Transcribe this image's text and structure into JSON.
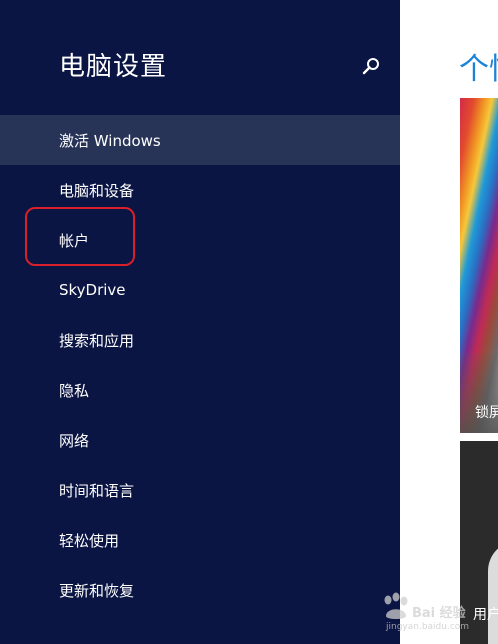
{
  "sidebar": {
    "title": "电脑设置",
    "search_icon": "search-icon",
    "items": [
      {
        "label": "激活 Windows",
        "selected": true
      },
      {
        "label": "电脑和设备",
        "selected": false
      },
      {
        "label": "帐户",
        "selected": false,
        "highlighted": true
      },
      {
        "label": "SkyDrive",
        "selected": false
      },
      {
        "label": "搜索和应用",
        "selected": false
      },
      {
        "label": "隐私",
        "selected": false
      },
      {
        "label": "网络",
        "selected": false
      },
      {
        "label": "时间和语言",
        "selected": false
      },
      {
        "label": "轻松使用",
        "selected": false
      },
      {
        "label": "更新和恢复",
        "selected": false
      }
    ]
  },
  "main": {
    "title": "个性化",
    "tiles": [
      {
        "label": "锁屏界面"
      },
      {
        "label": "用户头像"
      }
    ]
  },
  "watermark": {
    "brand": "Bai 经验",
    "url": "jingyan.baidu.com"
  },
  "colors": {
    "sidebar_bg": "#0b1543",
    "selected_bg": "#283457",
    "accent": "#1a83d6",
    "highlight_ring": "#d81f2a"
  }
}
